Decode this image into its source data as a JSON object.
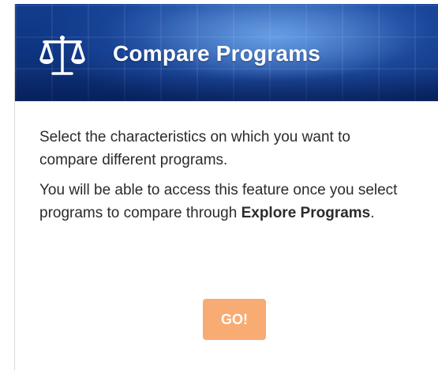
{
  "header": {
    "title": "Compare Programs",
    "icon": "balance-scale-icon"
  },
  "content": {
    "paragraph1": "Select the characteristics on which you want to compare different programs.",
    "paragraph2_prefix": "You will be able to access this feature once you select programs to compare through ",
    "paragraph2_link": "Explore Programs",
    "paragraph2_suffix": "."
  },
  "actions": {
    "go_label": "GO!"
  },
  "colors": {
    "banner": "#0e3582",
    "button": "#f8ab73",
    "text": "#2b2b2b"
  }
}
